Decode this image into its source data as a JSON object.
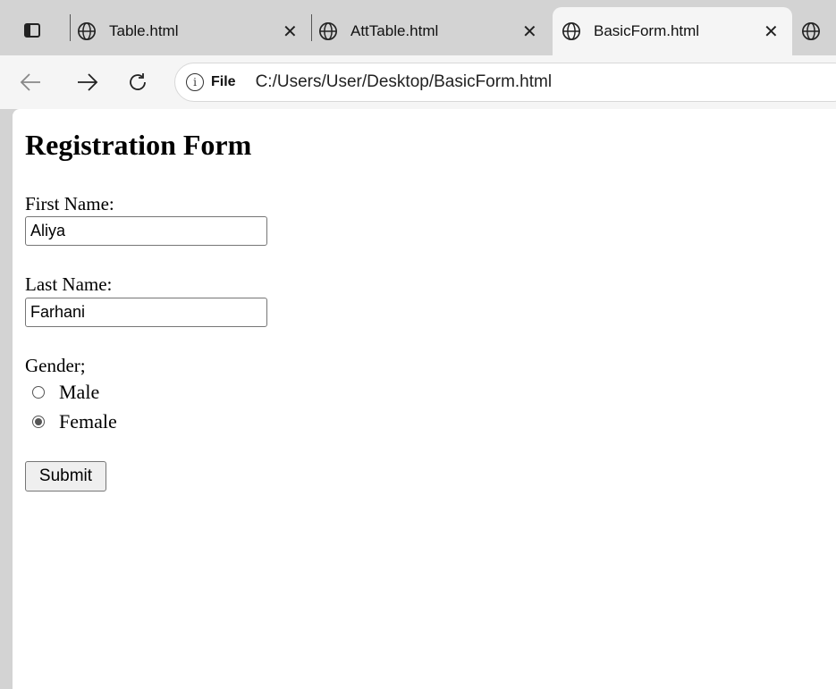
{
  "browser": {
    "tabs": [
      {
        "title": "Table.html",
        "active": false
      },
      {
        "title": "AttTable.html",
        "active": false
      },
      {
        "title": "BasicForm.html",
        "active": true
      }
    ],
    "address": {
      "scheme_label": "File",
      "url": "C:/Users/User/Desktop/BasicForm.html"
    }
  },
  "page": {
    "heading": "Registration Form",
    "first_name": {
      "label": "First Name:",
      "value": "Aliya"
    },
    "last_name": {
      "label": "Last Name:",
      "value": "Farhani"
    },
    "gender": {
      "label": "Gender;",
      "options": [
        {
          "label": "Male",
          "checked": false
        },
        {
          "label": "Female",
          "checked": true
        }
      ]
    },
    "submit_label": "Submit"
  },
  "icons": [
    "tab-actions-icon",
    "globe-icon",
    "close-icon",
    "back-icon",
    "forward-icon",
    "reload-icon",
    "info-icon"
  ]
}
